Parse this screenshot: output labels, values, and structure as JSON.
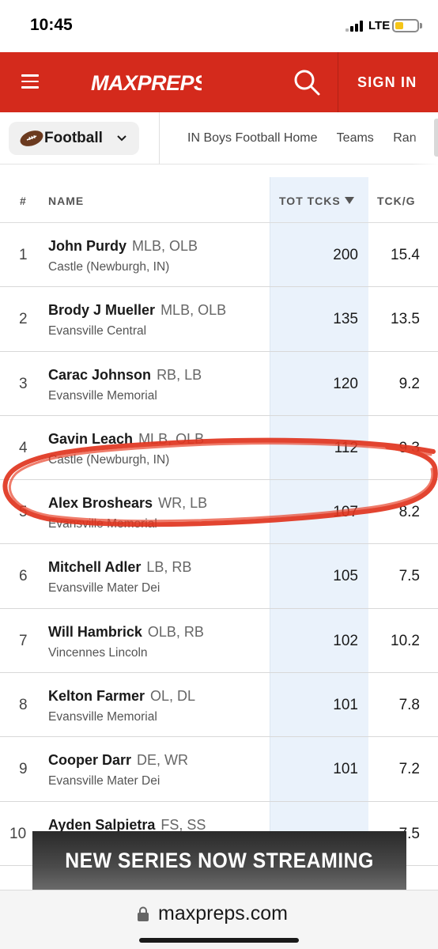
{
  "status_bar": {
    "time": "10:45",
    "network": "LTE",
    "battery_color": "#f5c518"
  },
  "header": {
    "brand_color": "#d42a1c",
    "logo_text": "MAXPREPS",
    "menu_icon": "hamburger-icon",
    "search_icon": "search-icon",
    "signin_label": "SIGN IN"
  },
  "sport_bar": {
    "sport_label": "Football",
    "sport_icon": "football-icon",
    "nav_links": [
      "IN Boys Football Home",
      "Teams",
      "Ran"
    ]
  },
  "table": {
    "columns": {
      "rank": "#",
      "name": "NAME",
      "tot_tcks": "TOT TCKS",
      "tck_g": "TCK/G"
    },
    "sorted_column": "TOT TCKS",
    "sort_direction": "descending",
    "rows": [
      {
        "rank": "1",
        "name": "John Purdy",
        "positions": "MLB, OLB",
        "school": "Castle (Newburgh, IN)",
        "tot": "200",
        "tckg": "15.4"
      },
      {
        "rank": "2",
        "name": "Brody J Mueller",
        "positions": "MLB, OLB",
        "school": "Evansville Central",
        "tot": "135",
        "tckg": "13.5"
      },
      {
        "rank": "3",
        "name": "Carac Johnson",
        "positions": "RB, LB",
        "school": "Evansville Memorial",
        "tot": "120",
        "tckg": "9.2"
      },
      {
        "rank": "4",
        "name": "Gavin Leach",
        "positions": "MLB, OLB",
        "school": "Castle (Newburgh, IN)",
        "tot": "112",
        "tckg": "9.3"
      },
      {
        "rank": "5",
        "name": "Alex Broshears",
        "positions": "WR, LB",
        "school": "Evansville Memorial",
        "tot": "107",
        "tckg": "8.2"
      },
      {
        "rank": "6",
        "name": "Mitchell Adler",
        "positions": "LB, RB",
        "school": "Evansville Mater Dei",
        "tot": "105",
        "tckg": "7.5"
      },
      {
        "rank": "7",
        "name": "Will Hambrick",
        "positions": "OLB, RB",
        "school": "Vincennes Lincoln",
        "tot": "102",
        "tckg": "10.2"
      },
      {
        "rank": "8",
        "name": "Kelton Farmer",
        "positions": "OL, DL",
        "school": "Evansville Memorial",
        "tot": "101",
        "tckg": "7.8"
      },
      {
        "rank": "9",
        "name": "Cooper Darr",
        "positions": "DE, WR",
        "school": "Evansville Mater Dei",
        "tot": "101",
        "tckg": "7.2"
      },
      {
        "rank": "10",
        "name": "Ayden Salpietra",
        "positions": "FS, SS",
        "school": "",
        "tot": "",
        "tckg": "7.5"
      }
    ],
    "highlighted_row": "2",
    "highlight_color": "#e0341e"
  },
  "ad": {
    "text": "NEW SERIES NOW STREAMING"
  },
  "url_bar": {
    "lock_icon": "lock-icon",
    "url": "maxpreps.com"
  }
}
